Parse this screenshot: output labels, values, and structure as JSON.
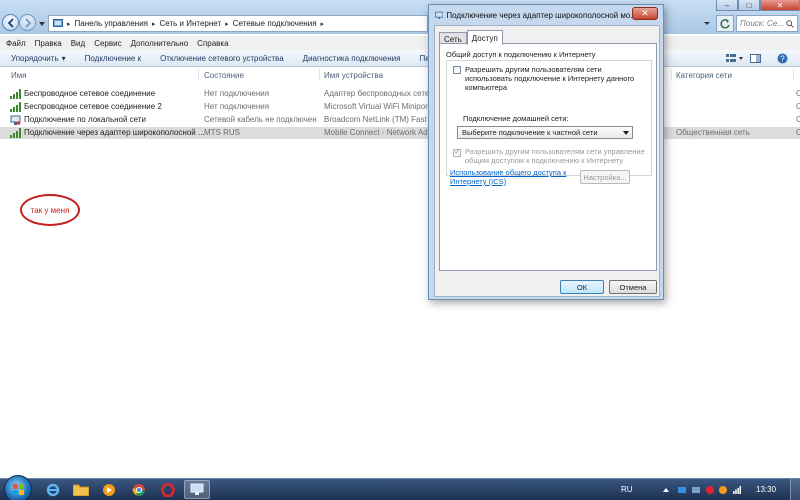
{
  "explorer": {
    "breadcrumb": [
      "Панель управления",
      "Сеть и Интернет",
      "Сетевые подключения"
    ],
    "search_placeholder": "Поиск: Се...",
    "menu": [
      "Файл",
      "Правка",
      "Вид",
      "Сервис",
      "Дополнительно",
      "Справка"
    ],
    "toolbar": [
      "Упорядочить",
      "Подключение к",
      "Отключение сетевого устройства",
      "Диагностика подключения",
      "Переи"
    ],
    "columns": [
      "Имя",
      "Состояние",
      "Имя устройства",
      "Категория сети"
    ],
    "rows": [
      {
        "name": "Беспроводное сетевое соединение",
        "status": "Нет подключения",
        "device": "Адаптер беспроводных сетей ",
        "category": "",
        "icon": "wireless-signal-icon"
      },
      {
        "name": "Беспроводное сетевое соединение 2",
        "status": "Нет подключения",
        "device": "Microsoft Virtual WiFi Miniport",
        "category": "",
        "icon": "wireless-signal-icon"
      },
      {
        "name": "Подключение по локальной сети",
        "status": "Сетевой кабель не подключен",
        "device": "Broadcom NetLink (TM) Fast Eth",
        "category": "",
        "icon": "ethernet-icon"
      },
      {
        "name": "Подключение через адаптер широкополосной ...",
        "status": "MTS RUS",
        "device": "Mobile Connect - Network Adap",
        "category": "Общественная сеть",
        "icon": "mobile-broadband-icon"
      }
    ],
    "right_edge_fragments": [
      "С",
      "С",
      "С",
      "С"
    ]
  },
  "annotation": {
    "text": "так у меня",
    "color": "#c41e1e"
  },
  "dialog": {
    "title": "Подключение через адаптер широкополосной мо...",
    "tabs": [
      "Сеть",
      "Доступ"
    ],
    "active_tab": "Доступ",
    "group_label": "Общий доступ к подключению к Интернету",
    "option1": {
      "text": "Разрешить другим пользователям сети использовать подключение к Интернету данного компьютера",
      "checked": false
    },
    "home_network_label": "Подключение домашней сети:",
    "home_network_select": "Выберите подключение к частной сети",
    "option2": {
      "text": "Разрешить другим пользователям сети управление общим доступом к подключению к Интернету",
      "checked": true,
      "disabled": true
    },
    "ics_link": "Использование общего доступа к Интернету (ICS)",
    "settings_button": "Настройка...",
    "ok_button": "ОК",
    "cancel_button": "Отмена"
  },
  "taskbar": {
    "language": "RU",
    "clock": "13:30"
  },
  "colors": {
    "accent": "#3c7fb1",
    "link": "#0066cc",
    "selection": "#dcdcdc",
    "annotation": "#c41e1e"
  }
}
